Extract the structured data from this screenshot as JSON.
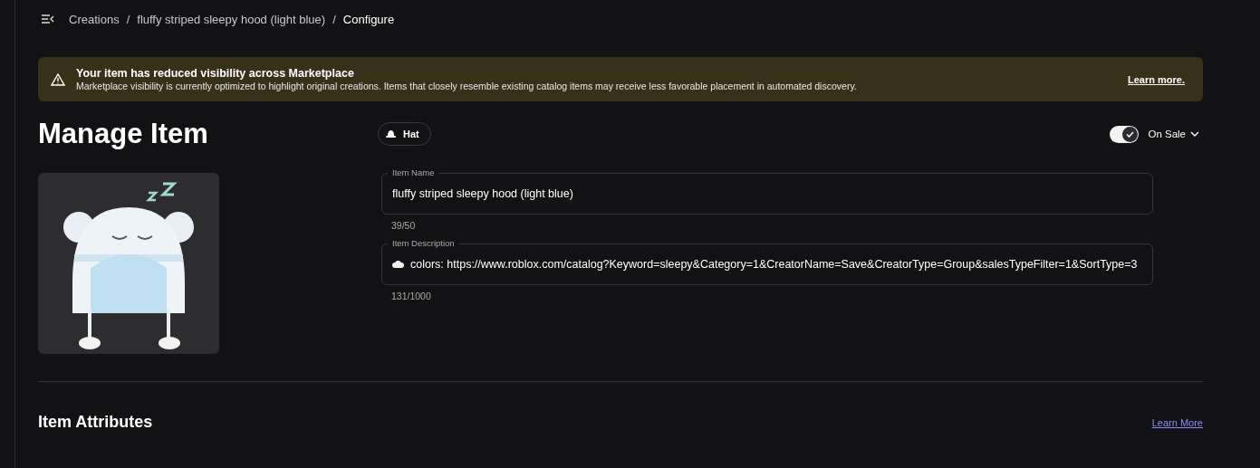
{
  "breadcrumb": [
    {
      "label": "Creations",
      "current": false
    },
    {
      "separator": "/",
      "label": "fluffy striped sleepy hood (light blue)",
      "current": false
    },
    {
      "separator": "/",
      "label": "Configure",
      "current": true
    }
  ],
  "banner": {
    "title": "Your item has reduced visibility across Marketplace",
    "message": "Marketplace visibility is currently optimized to highlight original creations. Items that closely resemble existing catalog items may receive less favorable placement in automated discovery.",
    "link": "Learn more."
  },
  "page_title": "Manage Item",
  "item_type": "Hat",
  "on_sale": {
    "label": "On Sale",
    "on": true
  },
  "fields": [
    {
      "label": "Item Name",
      "value": "fluffy striped sleepy hood (light blue)",
      "count": "39/50",
      "emoji": false
    },
    {
      "label": "Item Description",
      "value": "colors: https://www.roblox.com/catalog?Keyword=sleepy&Category=1&CreatorName=Save&CreatorType=Group&salesTypeFilter=1&SortType=3",
      "count": "131/1000",
      "emoji": true
    }
  ],
  "section": {
    "title": "Item Attributes",
    "link": "Learn More"
  }
}
